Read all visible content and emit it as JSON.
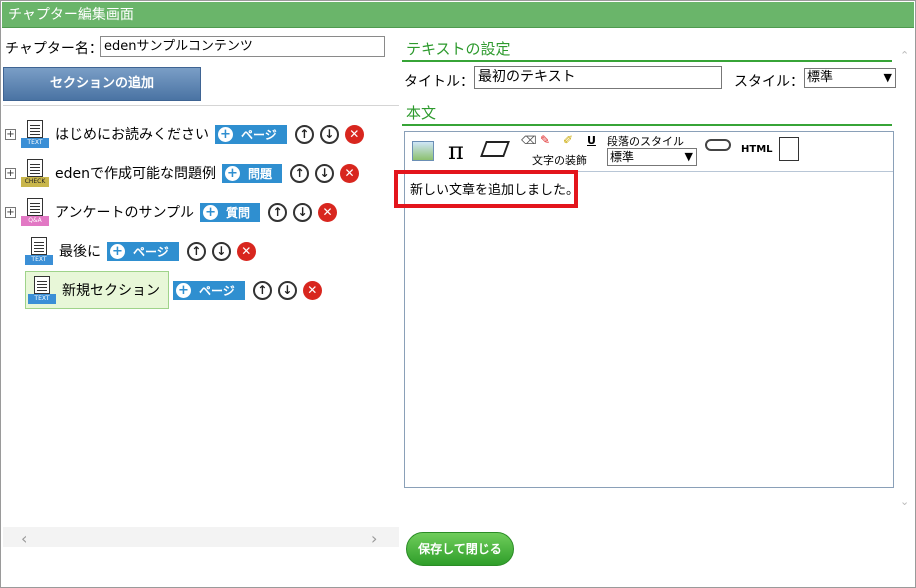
{
  "window": {
    "title": "チャプター編集画面"
  },
  "chapter": {
    "label": "チャプター名：",
    "value": "edenサンプルコンテンツ"
  },
  "add_section_label": "セクションの追加",
  "tree": [
    {
      "label": "はじめにお読みください",
      "tag": "TEXT",
      "button": "ページ"
    },
    {
      "label": "edenで作成可能な問題例",
      "tag": "CHECK",
      "button": "問題"
    },
    {
      "label": "アンケートのサンプル",
      "tag": "Q&A",
      "button": "質問"
    },
    {
      "label": "最後に",
      "tag": "TEXT",
      "button": "ページ"
    },
    {
      "label": "新規セクション",
      "tag": "TEXT",
      "button": "ページ"
    }
  ],
  "right": {
    "settings_title": "テキストの設定",
    "title_label": "タイトル：",
    "title_value": "最初のテキスト",
    "style_label": "スタイル：",
    "style_value": "標準",
    "body_heading": "本文",
    "toolbar": {
      "pi_symbol": "π",
      "decoration_label": "文字の装飾",
      "underline_symbol": "U",
      "paragraph_style_label": "段落のスタイル",
      "paragraph_style_value": "標準",
      "html_label": "HTML"
    },
    "body_text": "新しい文章を追加しました。"
  },
  "save_button_label": "保存して閉じる",
  "colors": {
    "accent_green": "#6ab56a",
    "highlight_red": "#e3151c",
    "pill_blue": "#2f8fd0"
  }
}
